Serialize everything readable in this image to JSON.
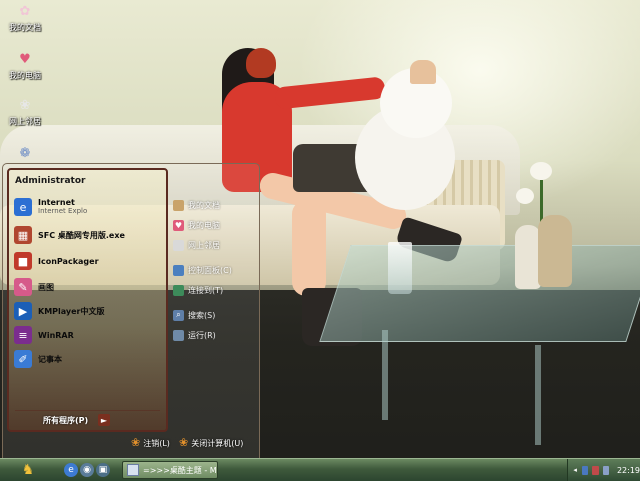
{
  "desktop": {
    "icons": [
      {
        "label": "我的文档",
        "icon": "folder-icon",
        "color": "#f1c6d6"
      },
      {
        "label": "我的电脑",
        "icon": "computer-icon",
        "color": "#e05b7a"
      },
      {
        "label": "网上邻居",
        "icon": "network-icon",
        "color": "#e7e7e7"
      },
      {
        "label": "",
        "icon": "recycle-icon",
        "color": "#6f8ec6"
      }
    ]
  },
  "start_menu": {
    "user": "Administrator",
    "left_items": [
      {
        "title": "Internet",
        "subtitle": "Internet Explo",
        "icon": "ie-icon",
        "color": "#2c6fd3"
      },
      {
        "title": "SFC 桌酷网专用版.exe",
        "subtitle": "",
        "icon": "sfc-icon",
        "color": "#b0462f"
      },
      {
        "title": "IconPackager",
        "subtitle": "",
        "icon": "iconpackager-icon",
        "color": "#c0392b"
      },
      {
        "title": "画图",
        "subtitle": "",
        "icon": "paint-icon",
        "color": "#d65a8a"
      },
      {
        "title": "KMPlayer中文版",
        "subtitle": "",
        "icon": "kmplayer-icon",
        "color": "#1b5fb7"
      },
      {
        "title": "WinRAR",
        "subtitle": "",
        "icon": "winrar-icon",
        "color": "#7b2d8e"
      },
      {
        "title": "记事本",
        "subtitle": "",
        "icon": "notepad-icon",
        "color": "#3a7bd5"
      }
    ],
    "all_programs": "所有程序(P)",
    "right_items": [
      {
        "label": "我的文档",
        "icon": "documents-icon",
        "color": "#c9a36a"
      },
      {
        "label": "我的电脑",
        "icon": "computer-icon",
        "color": "#e05b7a"
      },
      {
        "label": "网上邻居",
        "icon": "network-icon",
        "color": "#d9d9d9"
      },
      {
        "label": "控制面板(C)",
        "icon": "control-panel-icon",
        "color": "#4b7fbf"
      },
      {
        "label": "连接到(T)",
        "icon": "connect-icon",
        "color": "#3d8b5a"
      },
      {
        "label": "搜索(S)",
        "icon": "search-icon",
        "color": "#5f7fa8"
      },
      {
        "label": "运行(R)",
        "icon": "run-icon",
        "color": "#6f8aa7"
      }
    ],
    "logoff": "注销(L)",
    "shutdown": "关闭计算机(U)"
  },
  "taskbar": {
    "task_label": "=>>>桌酷主题 - Mic...",
    "clock": "22:19",
    "colors": {
      "bar": "#3f5a3c",
      "tray": "#2f4a33"
    }
  }
}
